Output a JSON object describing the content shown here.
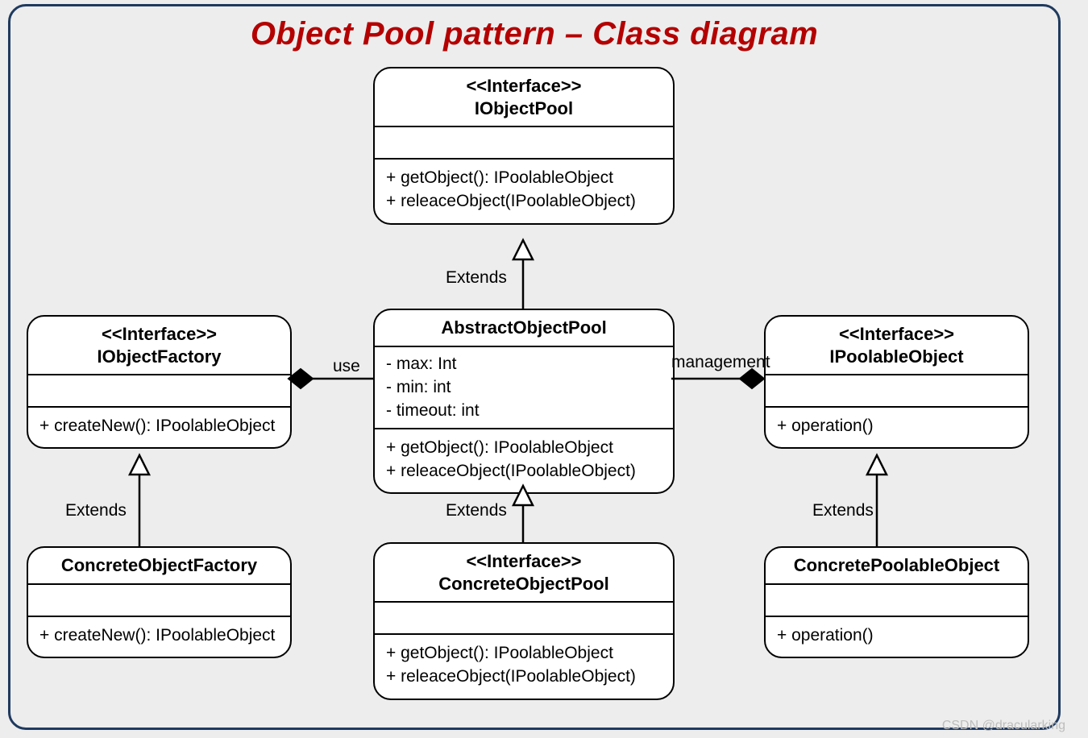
{
  "title": "Object Pool pattern – Class diagram",
  "watermark": "CSDN @dracularking",
  "boxes": {
    "iObjectPool": {
      "stereotype": "<<Interface>>",
      "name": "IObjectPool",
      "ops": [
        "+ getObject(): IPoolableObject",
        "+ releaceObject(IPoolableObject)"
      ]
    },
    "abstractObjectPool": {
      "name": "AbstractObjectPool",
      "attrs": [
        "- max: Int",
        "- min: int",
        "- timeout: int"
      ],
      "ops": [
        "+ getObject(): IPoolableObject",
        "+ releaceObject(IPoolableObject)"
      ]
    },
    "concreteObjectPool": {
      "stereotype": "<<Interface>>",
      "name": "ConcreteObjectPool",
      "ops": [
        "+ getObject(): IPoolableObject",
        "+ releaceObject(IPoolableObject)"
      ]
    },
    "iObjectFactory": {
      "stereotype": "<<Interface>>",
      "name": "IObjectFactory",
      "ops": [
        "+ createNew(): IPoolableObject"
      ]
    },
    "concreteObjectFactory": {
      "name": "ConcreteObjectFactory",
      "ops": [
        "+ createNew(): IPoolableObject"
      ]
    },
    "iPoolableObject": {
      "stereotype": "<<Interface>>",
      "name": "IPoolableObject",
      "ops": [
        "+ operation()"
      ]
    },
    "concretePoolableObject": {
      "name": "ConcretePoolableObject",
      "ops": [
        "+ operation()"
      ]
    }
  },
  "labels": {
    "extends1": "Extends",
    "extends2": "Extends",
    "extends3": "Extends",
    "extends4": "Extends",
    "use": "use",
    "management": "management"
  }
}
